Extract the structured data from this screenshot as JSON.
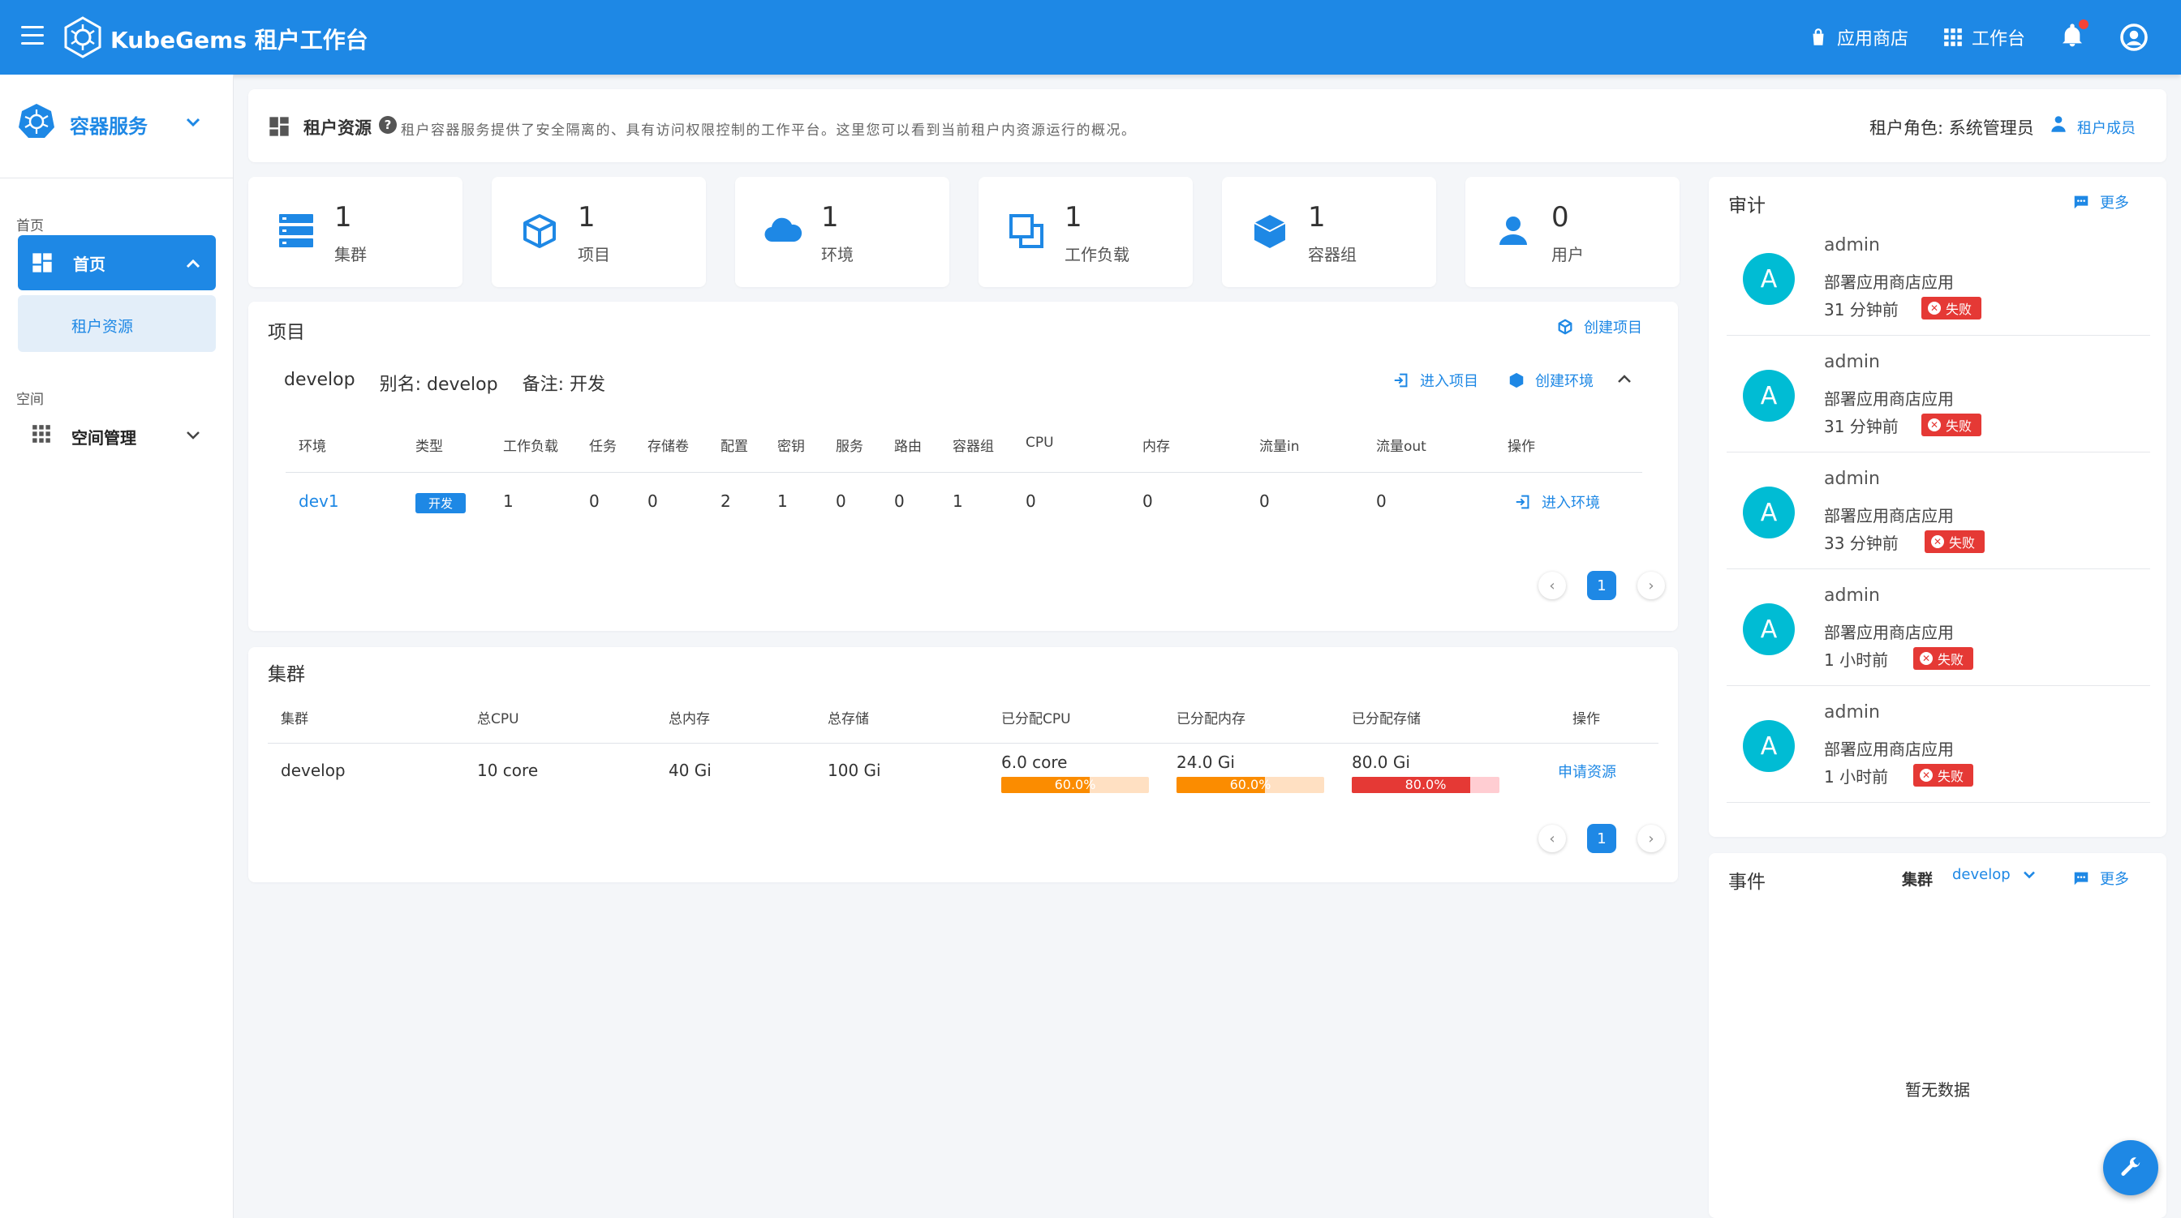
{
  "app": {
    "brand": "KubeGems 租户工作台",
    "top_links": {
      "app_store": "应用商店",
      "workbench": "工作台"
    }
  },
  "colors": {
    "primary": "#1e88e5",
    "orange": "#fb8c00",
    "orange_light": "#ffe0c2",
    "red": "#e53935",
    "red_light": "#ffcdd2",
    "teal": "#00bcd4"
  },
  "sidebar": {
    "service_title": "容器服务",
    "section_home": "首页",
    "home_label": "首页",
    "tenant_resource": "租户资源",
    "section_space": "空间",
    "space_manage": "空间管理"
  },
  "header": {
    "title": "租户资源",
    "description": "租户容器服务提供了安全隔离的、具有访问权限控制的工作平台。这里您可以看到当前租户内资源运行的概况。",
    "role": "租户角色: 系统管理员",
    "member_link": "租户成员"
  },
  "stats": [
    {
      "value": "1",
      "label": "集群",
      "icon": "server-stack-icon"
    },
    {
      "value": "1",
      "label": "项目",
      "icon": "cube-outline-icon"
    },
    {
      "value": "1",
      "label": "环境",
      "icon": "cloud-icon"
    },
    {
      "value": "1",
      "label": "工作负载",
      "icon": "copy-squares-icon"
    },
    {
      "value": "1",
      "label": "容器组",
      "icon": "cube-solid-icon"
    },
    {
      "value": "0",
      "label": "用户",
      "icon": "user-icon"
    }
  ],
  "project": {
    "title": "项目",
    "create_project": "创建项目",
    "name": "develop",
    "alias": "别名: develop",
    "remark": "备注: 开发",
    "enter_project": "进入项目",
    "create_env": "创建环境",
    "columns": [
      "环境",
      "类型",
      "工作负载",
      "任务",
      "存储卷",
      "配置",
      "密钥",
      "服务",
      "路由",
      "容器组",
      "CPU",
      "内存",
      "流量in",
      "流量out",
      "操作"
    ],
    "rows": [
      {
        "env": "dev1",
        "type": "开发",
        "workload": "1",
        "jobs": "0",
        "volumes": "0",
        "configs": "2",
        "secrets": "1",
        "services": "0",
        "routes": "0",
        "pods": "1",
        "cpu": "0",
        "memory": "0",
        "traffic_in": "0",
        "traffic_out": "0",
        "action": "进入环境"
      }
    ],
    "page": "1"
  },
  "cluster": {
    "title": "集群",
    "columns": [
      "集群",
      "总CPU",
      "总内存",
      "总存储",
      "已分配CPU",
      "已分配内存",
      "已分配存储",
      "操作"
    ],
    "rows": [
      {
        "name": "develop",
        "total_cpu": "10 core",
        "total_mem": "40 Gi",
        "total_storage": "100 Gi",
        "alloc_cpu": "6.0 core",
        "alloc_cpu_pct": 60,
        "alloc_cpu_pct_text": "60.0%",
        "alloc_mem": "24.0 Gi",
        "alloc_mem_pct": 60,
        "alloc_mem_pct_text": "60.0%",
        "alloc_storage": "80.0 Gi",
        "alloc_storage_pct": 80,
        "alloc_storage_pct_text": "80.0%",
        "action": "申请资源"
      }
    ],
    "page": "1"
  },
  "audit": {
    "title": "审计",
    "more": "更多",
    "items": [
      {
        "avatar": "A",
        "user": "admin",
        "action": "部署应用商店应用",
        "time": "31 分钟前",
        "status": "失败"
      },
      {
        "avatar": "A",
        "user": "admin",
        "action": "部署应用商店应用",
        "time": "31 分钟前",
        "status": "失败"
      },
      {
        "avatar": "A",
        "user": "admin",
        "action": "部署应用商店应用",
        "time": "33 分钟前",
        "status": "失败"
      },
      {
        "avatar": "A",
        "user": "admin",
        "action": "部署应用商店应用",
        "time": "1 小时前",
        "status": "失败"
      },
      {
        "avatar": "A",
        "user": "admin",
        "action": "部署应用商店应用",
        "time": "1 小时前",
        "status": "失败"
      }
    ]
  },
  "events": {
    "title": "事件",
    "cluster_label": "集群",
    "cluster_value": "develop",
    "more": "更多",
    "empty": "暂无数据"
  }
}
